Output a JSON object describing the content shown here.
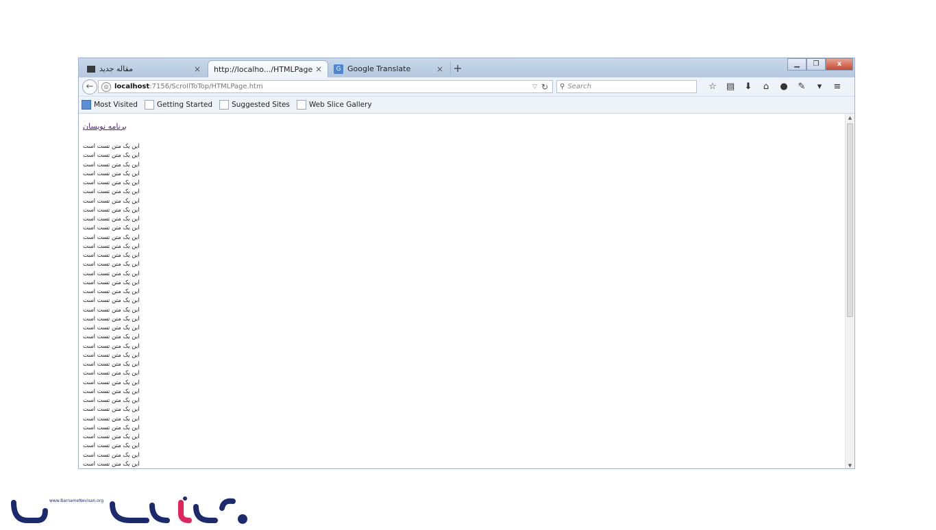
{
  "tabs": [
    {
      "label": "مقاله جدید"
    },
    {
      "label": "http://localho.../HTMLPage.htm"
    },
    {
      "label": "Google Translate"
    }
  ],
  "window_controls": {
    "minimize": "▁",
    "restore": "❐",
    "close": "x"
  },
  "address": {
    "host": "localhost",
    "path": ":7156/ScrollToTop/HTMLPage.htm"
  },
  "search": {
    "placeholder": "Search"
  },
  "bookmarks": [
    "Most Visited",
    "Getting Started",
    "Suggested Sites",
    "Web Slice Gallery"
  ],
  "page": {
    "link_text": "برنامه نویسان",
    "body_line": "این یک متن تست است",
    "line_count": 36
  },
  "logo": {
    "site_text": "www.BarnameNevisan.org"
  },
  "colors": {
    "logo_blue": "#1b2a6e",
    "logo_red": "#e0245e",
    "link": "#551a8b"
  }
}
